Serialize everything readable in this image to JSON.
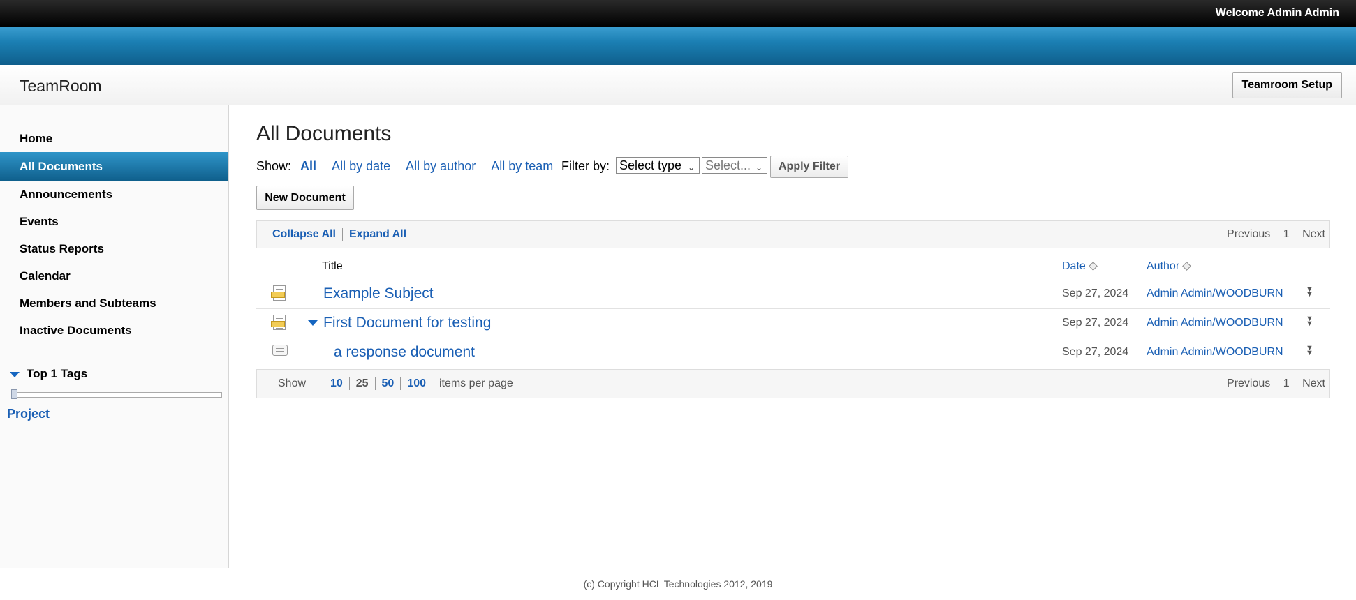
{
  "header": {
    "welcome": "Welcome Admin Admin"
  },
  "titlebar": {
    "app_title": "TeamRoom",
    "setup_label": "Teamroom Setup"
  },
  "sidebar": {
    "items": [
      {
        "label": "Home"
      },
      {
        "label": "All Documents",
        "active": true
      },
      {
        "label": "Announcements"
      },
      {
        "label": "Events"
      },
      {
        "label": "Status Reports"
      },
      {
        "label": "Calendar"
      },
      {
        "label": "Members and Subteams"
      },
      {
        "label": "Inactive Documents"
      }
    ],
    "tags_heading": "Top 1 Tags",
    "tags": [
      "Project"
    ]
  },
  "main": {
    "page_title": "All Documents",
    "show_label": "Show:",
    "show_links": [
      "All",
      "All by date",
      "All by author",
      "All by team"
    ],
    "filter_label": "Filter by:",
    "select_type": "Select type",
    "select_value": "Select...",
    "apply_filter": "Apply Filter",
    "new_document": "New Document",
    "collapse_all": "Collapse All",
    "expand_all": "Expand All",
    "pager": {
      "previous": "Previous",
      "page": "1",
      "next": "Next"
    },
    "columns": {
      "title": "Title",
      "date": "Date",
      "author": "Author"
    },
    "rows": [
      {
        "title": "Example Subject",
        "date": "Sep 27, 2024",
        "author": "Admin Admin/WOODBURN"
      },
      {
        "title": "First Document for testing",
        "date": "Sep 27, 2024",
        "author": "Admin Admin/WOODBURN"
      },
      {
        "title": "a response document",
        "date": "Sep 27, 2024",
        "author": "Admin Admin/WOODBURN"
      }
    ],
    "footer_show": "Show",
    "page_sizes": [
      "10",
      "25",
      "50",
      "100"
    ],
    "items_per_page": "items per page"
  },
  "footer": {
    "copyright": "(c) Copyright HCL Technologies 2012, 2019"
  },
  "colors": {
    "link": "#1a5fb4",
    "nav_active": "#1b7fb3",
    "topbar": "#000000"
  }
}
